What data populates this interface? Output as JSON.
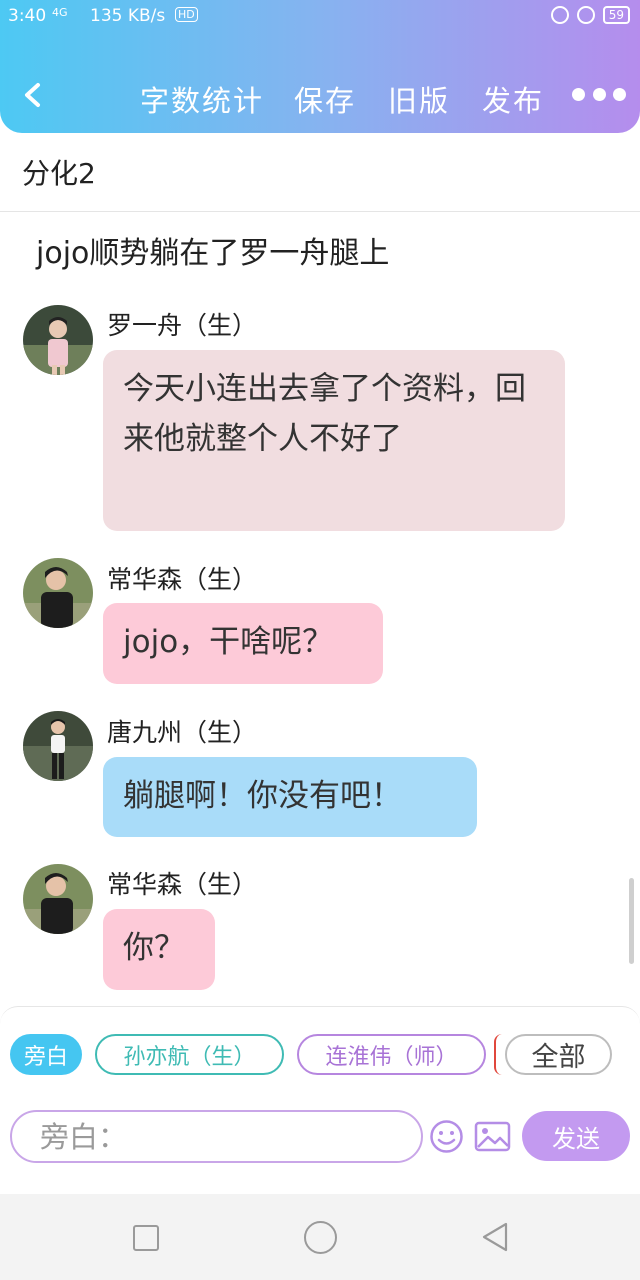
{
  "status_bar": {
    "time": "3:40",
    "signal": "4G",
    "speed": "135 KB/s",
    "hd": "HD",
    "battery": "59"
  },
  "header": {
    "word_count_label": "字数统计",
    "save_label": "保存",
    "old_version_label": "旧版",
    "publish_label": "发布"
  },
  "document": {
    "title": "分化2",
    "narration": "jojo顺势躺在了罗一舟腿上"
  },
  "messages": [
    {
      "sender": "罗一舟（生）",
      "text": "今天小连出去拿了个资料，回来他就整个人不好了"
    },
    {
      "sender": "常华森（生）",
      "text": "jojo，干啥呢？"
    },
    {
      "sender": "唐九州（生）",
      "text": "躺腿啊！你没有吧！"
    },
    {
      "sender": "常华森（生）",
      "text": "你？"
    }
  ],
  "role_chips": {
    "narrator": "旁白",
    "role_1": "孙亦航（生）",
    "role_2": "连淮伟（师）",
    "all": "全部"
  },
  "composer": {
    "placeholder": "旁白：",
    "send_label": "发送"
  },
  "colors": {
    "header_gradient_start": "#4dc9f3",
    "header_gradient_end": "#b58ded",
    "bubble_luo": "#f1dde0",
    "bubble_chang": "#fdcad8",
    "bubble_tang": "#a9dcf9",
    "send_button": "#c39af0"
  }
}
